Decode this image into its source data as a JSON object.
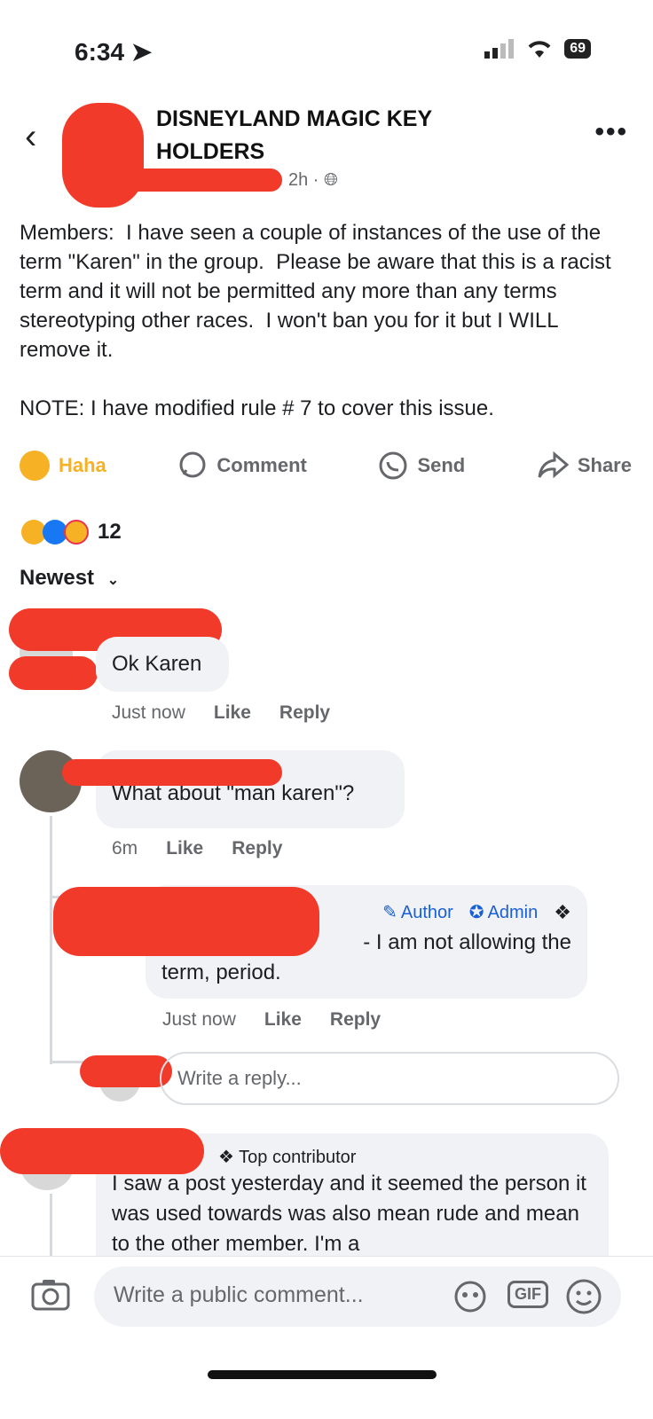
{
  "status_bar": {
    "time": "6:34",
    "battery": "69"
  },
  "header": {
    "title": "DISNEYLAND MAGIC KEY HOLDERS",
    "time": "2h"
  },
  "post": {
    "paragraph1": "Members:  I have seen a couple of instances of the use of the term \"Karen\" in the group.  Please be aware that this is a racist term and it will not be permitted any more than any terms stereotyping other races.  I won't ban you for it but I WILL remove it.",
    "paragraph2": "NOTE: I have modified rule # 7 to cover this issue."
  },
  "actions": {
    "haha": "Haha",
    "comment": "Comment",
    "send": "Send",
    "share": "Share"
  },
  "reactions": {
    "count": "12"
  },
  "sort": {
    "label": "Newest"
  },
  "comments": [
    {
      "text": "Ok Karen",
      "time": "Just now",
      "like": "Like",
      "reply": "Reply"
    },
    {
      "text": "What about \"man karen\"?",
      "time": "6m",
      "like": "Like",
      "reply": "Reply"
    }
  ],
  "reply": {
    "author_badge": "Author",
    "admin_badge": "Admin",
    "text_line1": "- I am not allowing the",
    "text_line2": "term, period.",
    "time": "Just now",
    "like": "Like",
    "reply": "Reply"
  },
  "write_reply": {
    "placeholder": "Write a reply..."
  },
  "comment3": {
    "badge": "Top contributor",
    "text": "I saw a post yesterday and it seemed the person it was used towards was also mean rude and mean to the other member. I'm a"
  },
  "composer": {
    "placeholder": "Write a public comment...",
    "gif": "GIF"
  },
  "colors": {
    "redaction": "#f23a2a",
    "admin_blue": "#1a5fd6",
    "haha_yellow": "#f7b125"
  }
}
